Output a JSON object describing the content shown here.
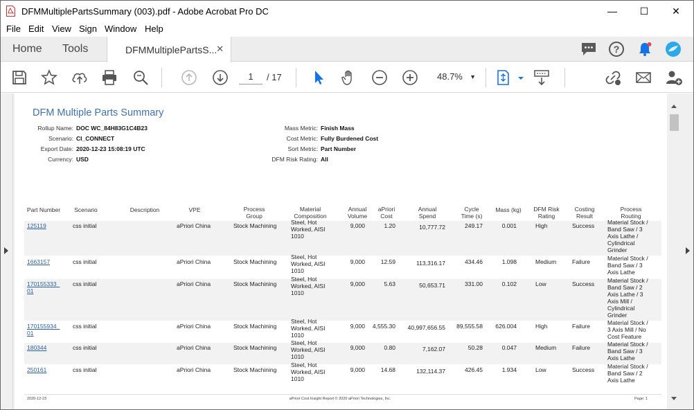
{
  "window": {
    "title": "DFMMultiplePartsSummary (003).pdf - Adobe Acrobat Pro DC",
    "minimize": "—",
    "maximize": "☐",
    "close": "✕"
  },
  "menu": [
    "File",
    "Edit",
    "View",
    "Sign",
    "Window",
    "Help"
  ],
  "tabs": {
    "home": "Home",
    "tools": "Tools",
    "doc": "DFMMultiplePartsS...",
    "doc_close": "✕"
  },
  "toolbar": {
    "page_current": "1",
    "page_total": "/ 17",
    "zoom": "48.7%"
  },
  "report": {
    "title": "DFM Multiple Parts Summary",
    "meta_left": [
      {
        "key": "Rollup Name:",
        "value": "DOC WC_84H83G1C4B23"
      },
      {
        "key": "Scenario:",
        "value": "CI_CONNECT"
      },
      {
        "key": "Export Date:",
        "value": "2020-12-23 15:08:19 UTC"
      },
      {
        "key": "Currency:",
        "value": "USD"
      }
    ],
    "meta_right": [
      {
        "key": "Mass Metric:",
        "value": "Finish Mass"
      },
      {
        "key": "Cost Metric:",
        "value": "Fully Burdened Cost"
      },
      {
        "key": "Sort Metric:",
        "value": "Part Number"
      },
      {
        "key": "DFM Risk Rating:",
        "value": "All"
      }
    ],
    "columns": [
      "Part Number",
      "Scenario",
      "Description",
      "VPE",
      "Process Group",
      "Material Composition",
      "Annual Volume",
      "aPriori Cost",
      "Annual Spend",
      "Cycle Time (s)",
      "Mass (kg)",
      "DFM Risk Rating",
      "Costing Result",
      "Process Routing"
    ],
    "rows": [
      {
        "part": [
          "125119"
        ],
        "scenario": "css initial",
        "description": "",
        "vpe": "aPriori China",
        "process_group": "Stock Machining",
        "material": [
          "Steel, Hot",
          "Worked, AISI",
          "1010"
        ],
        "volume": "9,000",
        "cost": "1.20",
        "spend": "10,777.72",
        "cycle": "249.17",
        "mass": "0.001",
        "risk": "High",
        "result": "Success",
        "routing": [
          "Material Stock /",
          "Band Saw / 3",
          "Axis Lathe /",
          "Cylindrical",
          "Grinder"
        ]
      },
      {
        "part": [
          "1663157"
        ],
        "scenario": "css initial",
        "description": "",
        "vpe": "aPriori China",
        "process_group": "Stock Machining",
        "material": [
          "Steel, Hot",
          "Worked, AISI",
          "1010"
        ],
        "volume": "9,000",
        "cost": "12.59",
        "spend": "113,316.17",
        "cycle": "434.46",
        "mass": "1.098",
        "risk": "Medium",
        "result": "Failure",
        "routing": [
          "Material Stock /",
          "Band Saw / 3",
          "Axis Lathe"
        ]
      },
      {
        "part": [
          "170155333_",
          "01"
        ],
        "scenario": "css initial",
        "description": "",
        "vpe": "aPriori China",
        "process_group": "Stock Machining",
        "material": [
          "Steel, Hot",
          "Worked, AISI",
          "1010"
        ],
        "volume": "9,000",
        "cost": "5.63",
        "spend": "50,653.71",
        "cycle": "331.00",
        "mass": "0.102",
        "risk": "Low",
        "result": "Success",
        "routing": [
          "Material Stock /",
          "Band Saw / 2",
          "Axis Lathe / 3",
          "Axis Mill /",
          "Cylindrical",
          "Grinder"
        ]
      },
      {
        "part": [
          "170155934_",
          "01"
        ],
        "scenario": "css initial",
        "description": "",
        "vpe": "aPriori China",
        "process_group": "Stock Machining",
        "material": [
          "Steel, Hot",
          "Worked, AISI",
          "1010"
        ],
        "volume": "9,000",
        "cost": "4,555.30",
        "spend": "40,997,656.55",
        "cycle": "89,555.58",
        "mass": "626.004",
        "risk": "High",
        "result": "Failure",
        "routing": [
          "Material Stock /",
          "3 Axis Mill / No",
          "Cost Feature"
        ]
      },
      {
        "part": [
          "180344"
        ],
        "scenario": "css initial",
        "description": "",
        "vpe": "aPriori China",
        "process_group": "Stock Machining",
        "material": [
          "Steel, Hot",
          "Worked, AISI",
          "1010"
        ],
        "volume": "9,000",
        "cost": "0.80",
        "spend": "7,162.07",
        "cycle": "50.28",
        "mass": "0.047",
        "risk": "Medium",
        "result": "Failure",
        "routing": [
          "Material Stock /",
          "Band Saw / 3",
          "Axis Lathe"
        ]
      },
      {
        "part": [
          "250161"
        ],
        "scenario": "css initial",
        "description": "",
        "vpe": "aPriori China",
        "process_group": "Stock Machining",
        "material": [
          "Steel, Hot",
          "Worked, AISI",
          "1010"
        ],
        "volume": "9,000",
        "cost": "14.68",
        "spend": "132,114.37",
        "cycle": "426.45",
        "mass": "1.934",
        "risk": "Low",
        "result": "Success",
        "routing": [
          "Material Stock /",
          "Band Saw / 2",
          "Axis Lathe"
        ]
      }
    ],
    "footer": {
      "left": "2020-12-23",
      "center": "aPriori Cost Insight Report © 2020 aPriori Technologies, Inc.",
      "right": "Page: 1"
    }
  },
  "colors": {
    "title_blue": "#3e72b5",
    "link_blue": "#2b5fa8",
    "notification_blue": "#1473e6",
    "select_blue": "#1473e6"
  }
}
